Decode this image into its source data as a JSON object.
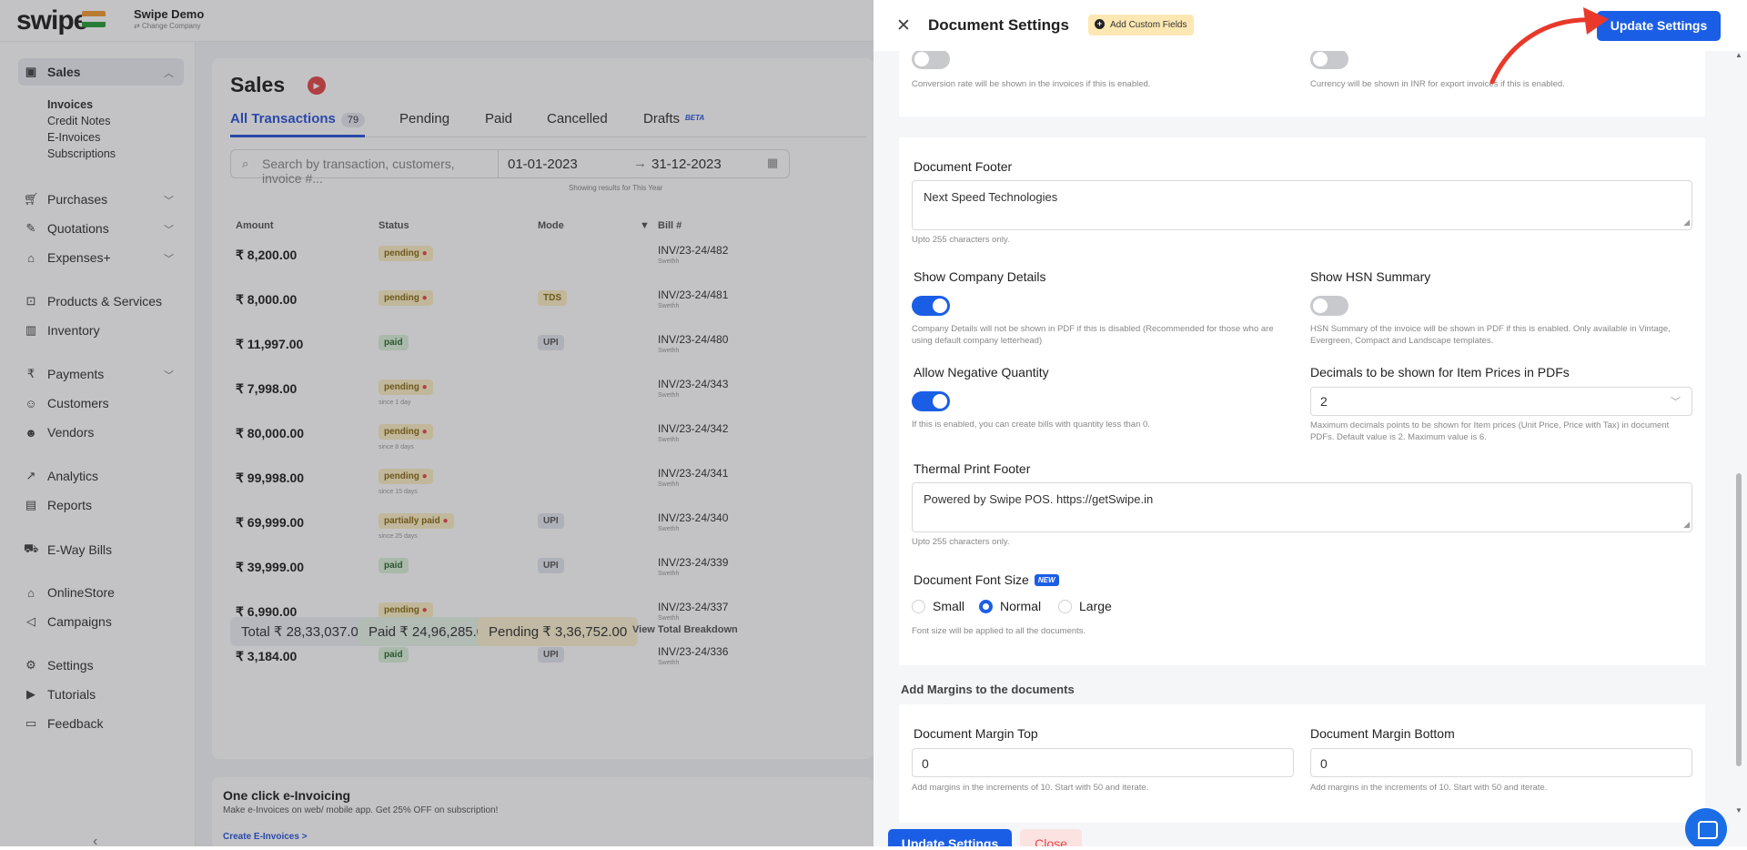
{
  "app": {
    "logo": "swipe",
    "company": "Swipe Demo",
    "change_company": "Change Company"
  },
  "sidebar": {
    "sales": "Sales",
    "sub": [
      "Invoices",
      "Credit Notes",
      "E-Invoices",
      "Subscriptions"
    ],
    "items": [
      "Purchases",
      "Quotations",
      "Expenses+",
      "Products & Services",
      "Inventory",
      "Payments",
      "Customers",
      "Vendors",
      "Analytics",
      "Reports",
      "E-Way Bills",
      "OnlineStore",
      "Campaigns",
      "Settings",
      "Tutorials",
      "Feedback"
    ]
  },
  "sales": {
    "title": "Sales",
    "tabs": [
      "All Transactions",
      "Pending",
      "Paid",
      "Cancelled",
      "Drafts"
    ],
    "all_count": "79",
    "drafts_badge": "BETA",
    "search_placeholder": "Search by transaction, customers, invoice #...",
    "date_from": "01-01-2023",
    "date_to": "31-12-2023",
    "showing": "Showing results for This Year",
    "columns": [
      "Amount",
      "Status",
      "Mode",
      "Bill #"
    ],
    "rows": [
      {
        "amount": "₹ 8,200.00",
        "status": "pending",
        "since": "",
        "mode": "",
        "bill": "INV/23-24/482"
      },
      {
        "amount": "₹ 8,000.00",
        "status": "pending",
        "since": "",
        "mode": "TDS",
        "bill": "INV/23-24/481"
      },
      {
        "amount": "₹ 11,997.00",
        "status": "paid",
        "since": "",
        "mode": "UPI",
        "bill": "INV/23-24/480"
      },
      {
        "amount": "₹ 7,998.00",
        "status": "pending",
        "since": "since 1 day",
        "mode": "",
        "bill": "INV/23-24/343"
      },
      {
        "amount": "₹ 80,000.00",
        "status": "pending",
        "since": "since 8 days",
        "mode": "",
        "bill": "INV/23-24/342"
      },
      {
        "amount": "₹ 99,998.00",
        "status": "pending",
        "since": "since 15 days",
        "mode": "",
        "bill": "INV/23-24/341"
      },
      {
        "amount": "₹ 69,999.00",
        "status": "partially paid",
        "since": "since 25 days",
        "mode": "UPI",
        "bill": "INV/23-24/340"
      },
      {
        "amount": "₹ 39,999.00",
        "status": "paid",
        "since": "",
        "mode": "UPI",
        "bill": "INV/23-24/339"
      },
      {
        "amount": "₹ 6,990.00",
        "status": "pending",
        "since": "since 29 days",
        "mode": "",
        "bill": "INV/23-24/337"
      },
      {
        "amount": "₹ 3,184.00",
        "status": "paid",
        "since": "",
        "mode": "UPI",
        "bill": "INV/23-24/336"
      }
    ],
    "bill_sub": "Swethh",
    "total": "Total ₹ 28,33,037.00",
    "paid": "Paid ₹ 24,96,285.00",
    "pending": "Pending ₹ 3,36,752.00",
    "breakdown": "View Total Breakdown",
    "einvoice_title": "One click e-Invoicing",
    "einvoice_text": "Make e-Invoices on web/ mobile app. Get 25% OFF on subscription!",
    "einvoice_link": "Create E-Invoices >"
  },
  "drawer": {
    "title": "Document Settings",
    "custom_fields": "Add Custom Fields",
    "update": "Update Settings",
    "close": "Close",
    "conversion_help": "Conversion rate will be shown in the invoices if this is enabled.",
    "currency_help": "Currency will be shown in INR for export invoices if this is enabled.",
    "footer_label": "Document Footer",
    "footer_value": "Next Speed Technologies",
    "chars_limit": "Upto 255 characters only.",
    "company_details_label": "Show Company Details",
    "company_details_help": "Company Details will not be shown in PDF if this is disabled (Recommended for those who are using default company letterhead)",
    "hsn_label": "Show HSN Summary",
    "hsn_help": "HSN Summary of the invoice will be shown in PDF if this is enabled. Only available in Vintage, Evergreen, Compact and Landscape templates.",
    "neg_qty_label": "Allow Negative Quantity",
    "neg_qty_help": "If this is enabled, you can create bills with quantity less than 0.",
    "decimals_label": "Decimals to be shown for Item Prices in PDFs",
    "decimals_value": "2",
    "decimals_help": "Maximum decimals points to be shown for Item prices (Unit Price, Price with Tax) in document PDFs. Default value is 2. Maximum value is 6.",
    "thermal_label": "Thermal Print Footer",
    "thermal_value": "Powered by Swipe POS. https://getSwipe.in",
    "font_size_label": "Document Font Size",
    "new_badge": "NEW",
    "font_sizes": [
      "Small",
      "Normal",
      "Large"
    ],
    "font_selected": "Normal",
    "font_help": "Font size will be applied to all the documents.",
    "margins_title": "Add Margins to the documents",
    "margin_top_label": "Document Margin Top",
    "margin_top_value": "0",
    "margin_bottom_label": "Document Margin Bottom",
    "margin_bottom_value": "0",
    "margin_help": "Add margins in the increments of 10. Start with 50 and iterate."
  },
  "colors": {
    "accent": "#1b5ee6",
    "danger": "#e54848",
    "arrow": "#e8392b"
  }
}
